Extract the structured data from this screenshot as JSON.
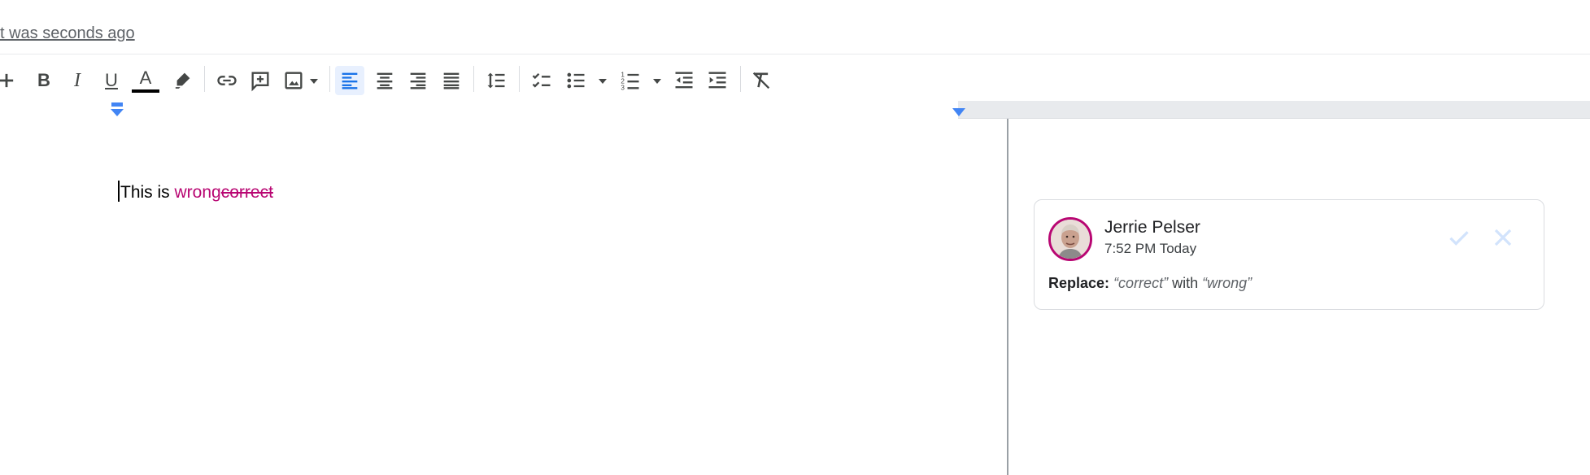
{
  "header": {
    "last_edit_text": "t was seconds ago"
  },
  "toolbar": {
    "buttons": [
      {
        "name": "add",
        "icon": "plus-icon"
      },
      {
        "name": "bold",
        "icon": "bold-icon",
        "label": "B"
      },
      {
        "name": "italic",
        "icon": "italic-icon",
        "label": "I"
      },
      {
        "name": "underline",
        "icon": "underline-icon",
        "label": "U"
      },
      {
        "name": "text-color",
        "icon": "text-color-icon",
        "label": "A"
      },
      {
        "name": "highlight",
        "icon": "highlighter-icon"
      },
      {
        "name": "insert-link",
        "icon": "link-icon"
      },
      {
        "name": "add-comment",
        "icon": "comment-add-icon"
      },
      {
        "name": "insert-image",
        "icon": "image-icon"
      },
      {
        "name": "align-left",
        "icon": "align-left-icon",
        "active": true
      },
      {
        "name": "align-center",
        "icon": "align-center-icon"
      },
      {
        "name": "align-right",
        "icon": "align-right-icon"
      },
      {
        "name": "justify",
        "icon": "align-justify-icon"
      },
      {
        "name": "line-spacing",
        "icon": "line-spacing-icon"
      },
      {
        "name": "checklist",
        "icon": "checklist-icon"
      },
      {
        "name": "bulleted-list",
        "icon": "bulleted-list-icon"
      },
      {
        "name": "numbered-list",
        "icon": "numbered-list-icon"
      },
      {
        "name": "decrease-indent",
        "icon": "indent-decrease-icon"
      },
      {
        "name": "increase-indent",
        "icon": "indent-increase-icon"
      },
      {
        "name": "clear-formatting",
        "icon": "clear-formatting-icon"
      }
    ],
    "colors": {
      "icon": "#444746",
      "active_bg": "#e8f0fe",
      "active_icon": "#1a73e8",
      "text_color_bar": "#000000"
    }
  },
  "document": {
    "text_before": "This is ",
    "inserted_text": "wrong",
    "deleted_text": "correct",
    "suggestion_color": "#b80672"
  },
  "suggestion_card": {
    "author": "Jerrie Pelser",
    "time": "7:52 PM Today",
    "action_label": "Replace:",
    "original": "“correct”",
    "connector": "with",
    "replacement": "“wrong”",
    "accept_icon": "check-icon",
    "reject_icon": "close-icon"
  }
}
